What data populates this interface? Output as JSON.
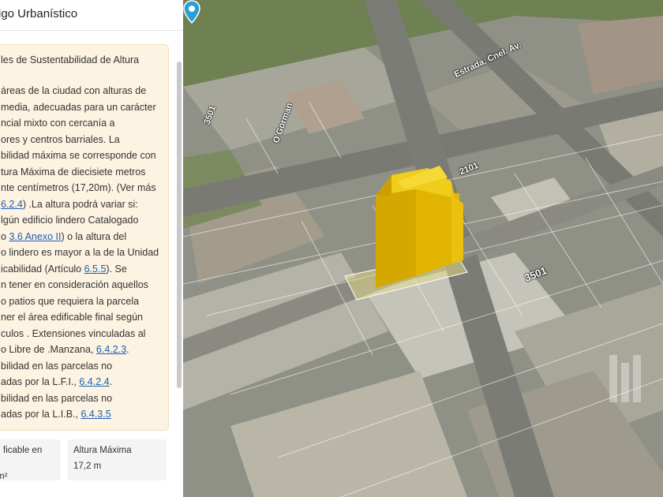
{
  "panel": {
    "title": "igo Urbanístico",
    "heading": "les de Sustentabilidad de Altura",
    "lines": [
      {
        "text": "áreas de la ciudad con alturas de"
      },
      {
        "text": "media, adecuadas para un carácter"
      },
      {
        "text": "ncial mixto con cercanía a"
      },
      {
        "text": "ores y centros barriales. La"
      },
      {
        "text": "bilidad máxima se corresponde con"
      },
      {
        "text": "tura Máxima de diecisiete metros"
      },
      {
        "text": "nte centímetros (17,20m). (Ver más"
      },
      {
        "link": "6.2.4",
        "text": ") .La altura podrá variar si:"
      },
      {
        "text": "lgún edificio lindero Catalogado"
      },
      {
        "pre": "o ",
        "link": "3.6 Anexo II",
        "text": ") o la altura del"
      },
      {
        "text": "o lindero es mayor a la de la Unidad"
      },
      {
        "pre": "icabilidad (Artículo ",
        "link": "6.5.5",
        "text": "). Se"
      },
      {
        "text": "n tener en consideración aquellos"
      },
      {
        "text": "o patios que requiera la parcela"
      },
      {
        "text": "ner el área edificable final según"
      },
      {
        "text": "culos . Extensiones vinculadas al"
      },
      {
        "pre": "o Libre de .Manzana, ",
        "link": "6.4.2.3",
        "text": "."
      },
      {
        "text": "bilidad en las parcelas no"
      },
      {
        "pre": "adas por la L.F.I., ",
        "link": "6.4.2.4",
        "text": "."
      },
      {
        "text": "bilidad en las parcelas no"
      },
      {
        "pre": "adas por la L.I.B., ",
        "link": "6.4.3.5",
        "text": ""
      }
    ],
    "cards": [
      {
        "label": "ficable en",
        "value": "m²"
      },
      {
        "label": "Altura Máxima",
        "value": "17,2 m"
      }
    ]
  },
  "map": {
    "street_labels": [
      "3501",
      "3501",
      "2101",
      "O'Gorman",
      "Estrada, Cnel. Av."
    ],
    "building_color": "#e6b800",
    "pin_color": "#2a9fd6"
  }
}
